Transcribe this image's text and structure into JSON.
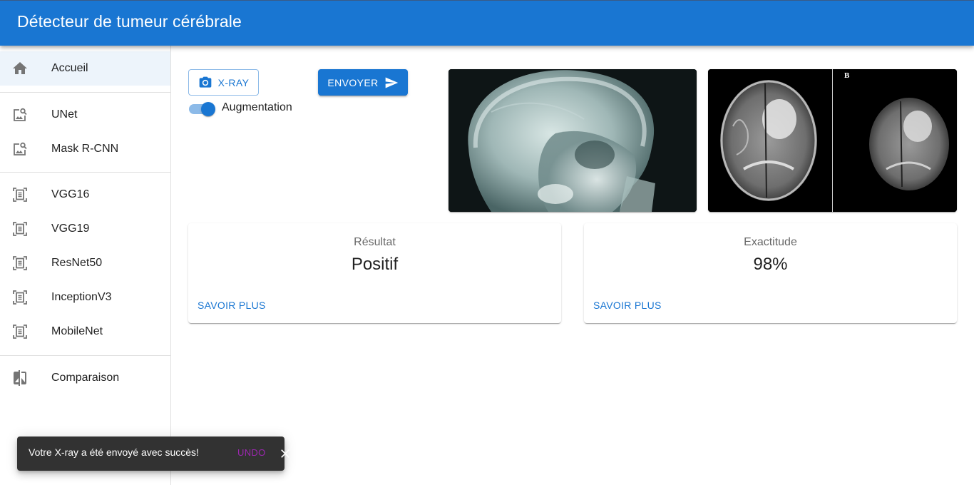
{
  "app": {
    "title": "Détecteur de tumeur cérébrale"
  },
  "sidebar": {
    "items": [
      {
        "label": "Accueil",
        "icon": "home-icon",
        "selected": true
      },
      {
        "label": "UNet",
        "icon": "image-search-icon"
      },
      {
        "label": "Mask R-CNN",
        "icon": "image-search-icon"
      },
      {
        "label": "VGG16",
        "icon": "document-scanner-icon"
      },
      {
        "label": "VGG19",
        "icon": "document-scanner-icon"
      },
      {
        "label": "ResNet50",
        "icon": "document-scanner-icon"
      },
      {
        "label": "InceptionV3",
        "icon": "document-scanner-icon"
      },
      {
        "label": "MobileNet",
        "icon": "document-scanner-icon"
      },
      {
        "label": "Comparaison",
        "icon": "compare-icon"
      }
    ]
  },
  "toolbar": {
    "xray_label": "X-RAY",
    "send_label": "ENVOYER",
    "augmentation_label": "Augmentation",
    "augmentation_on": true
  },
  "images": {
    "mri_panel_letter": "B"
  },
  "result_card": {
    "label": "Résultat",
    "value": "Positif",
    "link": "SAVOIR PLUS"
  },
  "accuracy_card": {
    "label": "Exactitude",
    "value": "98%",
    "link": "SAVOIR PLUS"
  },
  "snackbar": {
    "message": "Votre X-ray a été envoyé avec succès!",
    "action": "UNDO"
  },
  "colors": {
    "primary": "#1976d2",
    "snackbar_bg": "#323232",
    "undo": "#9c27b0"
  }
}
